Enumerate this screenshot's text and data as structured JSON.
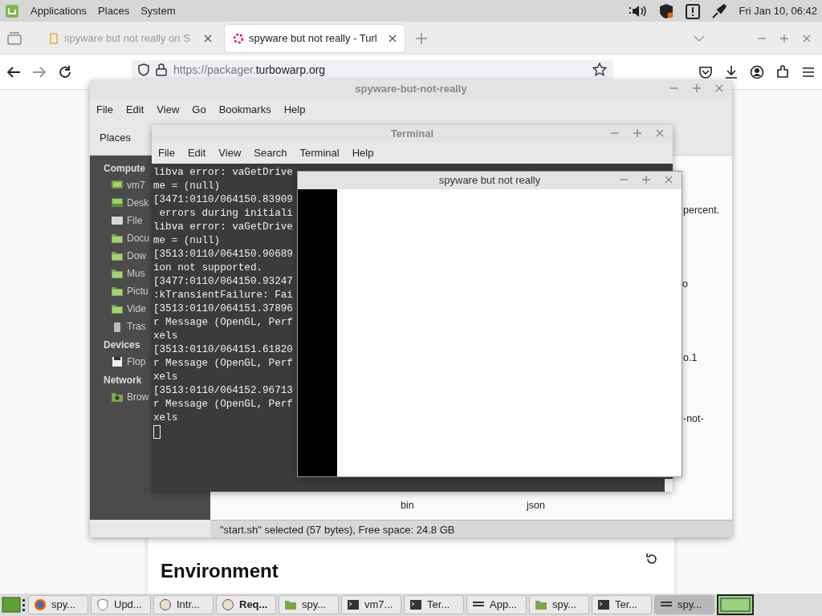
{
  "top_panel": {
    "menus": [
      "Applications",
      "Places",
      "System"
    ],
    "clock": "Fri Jan 10, 06:42"
  },
  "browser": {
    "tabs": [
      {
        "title": "spyware but not really on S",
        "selected": false
      },
      {
        "title": "spyware but not really - Turl",
        "selected": true
      }
    ],
    "url_prefix": "https://packager.",
    "url_domain": "turbowarp.org",
    "page_heading": "Environment"
  },
  "file_manager": {
    "title": "spyware-but-not-really",
    "menus": [
      "File",
      "Edit",
      "View",
      "Go",
      "Bookmarks",
      "Help"
    ],
    "places_label": "Places",
    "sidebar": [
      {
        "heading": "Compute",
        "items": [
          {
            "label": "vm7",
            "kind": "computer"
          },
          {
            "label": "Desk",
            "kind": "desktop"
          },
          {
            "label": "File",
            "kind": "drive"
          },
          {
            "label": "Docu",
            "kind": "folder"
          },
          {
            "label": "Dow",
            "kind": "folder"
          },
          {
            "label": "Mus",
            "kind": "folder"
          },
          {
            "label": "Pictu",
            "kind": "folder"
          },
          {
            "label": "Vide",
            "kind": "folder"
          },
          {
            "label": "Tras",
            "kind": "trash"
          }
        ]
      },
      {
        "heading": "Devices",
        "items": [
          {
            "label": "Flop",
            "kind": "floppy"
          }
        ]
      },
      {
        "heading": "Network",
        "items": [
          {
            "label": "Brow",
            "kind": "network"
          }
        ]
      }
    ],
    "files": [
      "percent.",
      "o",
      "o.1",
      "-not-",
      "bin",
      "json"
    ],
    "status": "\"start.sh\" selected (57 bytes), Free space: 24.8 GB"
  },
  "terminal": {
    "title": "Terminal",
    "menus": [
      "File",
      "Edit",
      "View",
      "Search",
      "Terminal",
      "Help"
    ],
    "lines": [
      "libva error: vaGetDrive",
      "me = (null)",
      "[3471:0110/064150.83909",
      " errors during initiali",
      "libva error: vaGetDrive",
      "me = (null)",
      "[3513:0110/064150.90689",
      "ion not supported.",
      "[3477:0110/064150.93247",
      ":kTransientFailure: Fai",
      "[3513:0110/064151.37896",
      "r Message (OpenGL, Perf",
      "xels",
      "[3513:0110/064151.61820",
      "r Message (OpenGL, Perf",
      "xels",
      "[3513:0110/064152.96713",
      "r Message (OpenGL, Perf",
      "xels"
    ]
  },
  "app_window": {
    "title": "spyware but not really"
  },
  "taskbar": [
    {
      "label": "spy...",
      "kind": "browser",
      "selected": false,
      "urgent": false
    },
    {
      "label": "Upd...",
      "kind": "shield",
      "selected": false,
      "urgent": false
    },
    {
      "label": "Intr...",
      "kind": "app",
      "selected": false,
      "urgent": false
    },
    {
      "label": "Req...",
      "kind": "app",
      "selected": false,
      "urgent": true
    },
    {
      "label": "spy...",
      "kind": "folder",
      "selected": false,
      "urgent": false
    },
    {
      "label": "vm7...",
      "kind": "terminal",
      "selected": false,
      "urgent": false
    },
    {
      "label": "Ter...",
      "kind": "terminal",
      "selected": false,
      "urgent": false
    },
    {
      "label": "App...",
      "kind": "window",
      "selected": false,
      "urgent": false
    },
    {
      "label": "spy...",
      "kind": "folder",
      "selected": false,
      "urgent": false
    },
    {
      "label": "Ter...",
      "kind": "terminal",
      "selected": false,
      "urgent": false
    },
    {
      "label": "spy...",
      "kind": "window",
      "selected": true,
      "urgent": false
    }
  ]
}
